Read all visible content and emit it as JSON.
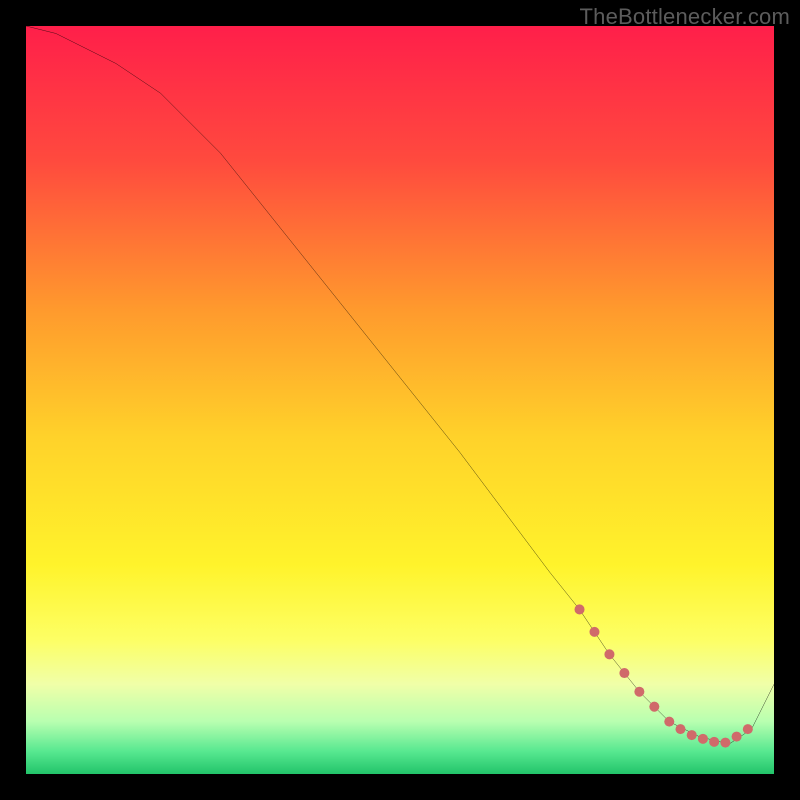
{
  "watermark": "TheBottlenecker.com",
  "chart_data": {
    "type": "line",
    "title": "",
    "xlabel": "",
    "ylabel": "",
    "xlim": [
      0,
      100
    ],
    "ylim": [
      0,
      100
    ],
    "background_gradient": {
      "direction": "vertical",
      "stops": [
        {
          "pos": 0.0,
          "color": "#ff1f4a"
        },
        {
          "pos": 0.18,
          "color": "#ff4a3e"
        },
        {
          "pos": 0.38,
          "color": "#ff9a2d"
        },
        {
          "pos": 0.55,
          "color": "#ffd22a"
        },
        {
          "pos": 0.72,
          "color": "#fff32b"
        },
        {
          "pos": 0.82,
          "color": "#fdff64"
        },
        {
          "pos": 0.88,
          "color": "#f0ffa8"
        },
        {
          "pos": 0.93,
          "color": "#b8ffb0"
        },
        {
          "pos": 0.97,
          "color": "#57e890"
        },
        {
          "pos": 1.0,
          "color": "#22c46a"
        }
      ]
    },
    "series": [
      {
        "name": "curve",
        "color": "#000000",
        "x": [
          0,
          4,
          8,
          12,
          18,
          26,
          34,
          42,
          50,
          58,
          64,
          70,
          74,
          78,
          82,
          86,
          90,
          94,
          97,
          100
        ],
        "y": [
          100,
          99,
          97,
          95,
          91,
          83,
          73,
          63,
          53,
          43,
          35,
          27,
          22,
          16,
          11,
          7,
          5,
          4,
          6,
          12
        ]
      }
    ],
    "markers": {
      "name": "highlight-dots",
      "color": "#d06a6a",
      "radius": 5,
      "points": [
        {
          "x": 74,
          "y": 22
        },
        {
          "x": 76,
          "y": 19
        },
        {
          "x": 78,
          "y": 16
        },
        {
          "x": 80,
          "y": 13.5
        },
        {
          "x": 82,
          "y": 11
        },
        {
          "x": 84,
          "y": 9
        },
        {
          "x": 86,
          "y": 7
        },
        {
          "x": 87.5,
          "y": 6
        },
        {
          "x": 89,
          "y": 5.2
        },
        {
          "x": 90.5,
          "y": 4.7
        },
        {
          "x": 92,
          "y": 4.3
        },
        {
          "x": 93.5,
          "y": 4.2
        },
        {
          "x": 95,
          "y": 5.0
        },
        {
          "x": 96.5,
          "y": 6.0
        }
      ]
    }
  }
}
